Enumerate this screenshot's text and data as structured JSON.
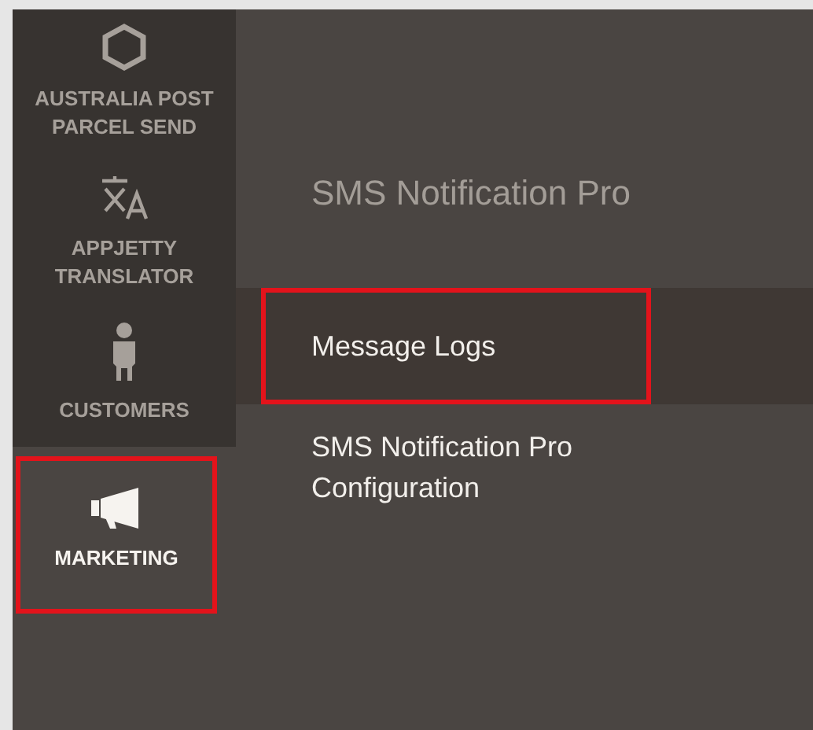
{
  "sidebar": {
    "items": [
      {
        "kind": "hexagon",
        "label": "AUSTRALIA POST PARCEL SEND",
        "selected": false,
        "highlighted": false
      },
      {
        "kind": "translate",
        "label": "APPJETTY TRANSLATOR",
        "selected": false,
        "highlighted": false
      },
      {
        "kind": "person",
        "label": "CUSTOMERS",
        "selected": false,
        "highlighted": false
      },
      {
        "kind": "megaphone",
        "label": "MARKETING",
        "selected": true,
        "highlighted": true
      }
    ]
  },
  "submenu": {
    "title": "SMS Notification Pro",
    "items": [
      {
        "label": "Message Logs",
        "selected": true,
        "highlighted": true
      },
      {
        "label": "SMS Notification Pro Configuration",
        "selected": false,
        "highlighted": false
      }
    ]
  }
}
